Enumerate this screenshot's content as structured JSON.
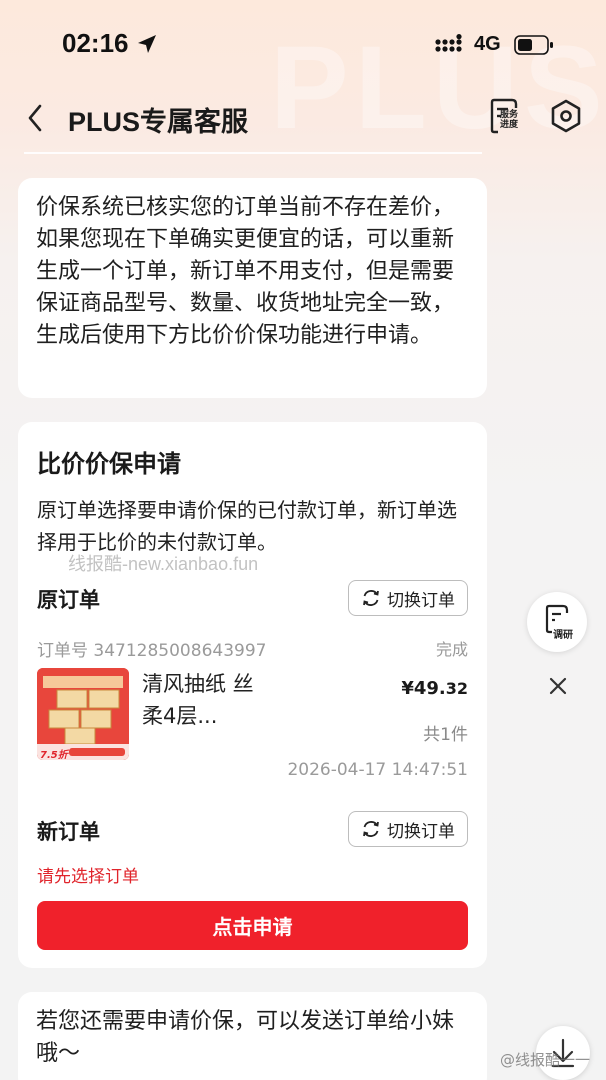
{
  "status_bar": {
    "time": "02:16",
    "network": "4G"
  },
  "header": {
    "title": "PLUS专属客服",
    "progress_label": "服务进度"
  },
  "background_watermark": "PLUS",
  "messages": [
    {
      "text": "价保系统已核实您的订单当前不存在差价，如果您现在下单确实更便宜的话，可以重新生成一个订单，新订单不用支付，但是需要保证商品型号、数量、收货地址完全一致，生成后使用下方比价价保功能进行申请。"
    },
    {
      "text": "若您还需要申请价保，可以发送订单给小妹哦～"
    }
  ],
  "apply_card": {
    "title": "比价价保申请",
    "description": "原订单选择要申请价保的已付款订单，新订单选择用于比价的未付款订单。",
    "watermark": "线报酷-new.xianbao.fun",
    "original_label": "原订单",
    "new_label": "新订单",
    "switch_label": "切换订单",
    "order_no": "订单号 3471285008643997",
    "order_status": "完成",
    "product_name": "清风抽纸 丝柔4层...",
    "price_main": "¥49.",
    "price_cents": "32",
    "quantity": "共1件",
    "order_time": "2026-04-17 14:47:51",
    "error": "请先选择订单",
    "submit_label": "点击申请",
    "product_image_badge": "7.5折"
  },
  "floating": {
    "survey_label": "调研",
    "weibo_watermark": "@线报酷一一"
  },
  "colors": {
    "accent": "#f0212b",
    "error": "#e0242b",
    "background_top": "#fde9dc"
  }
}
